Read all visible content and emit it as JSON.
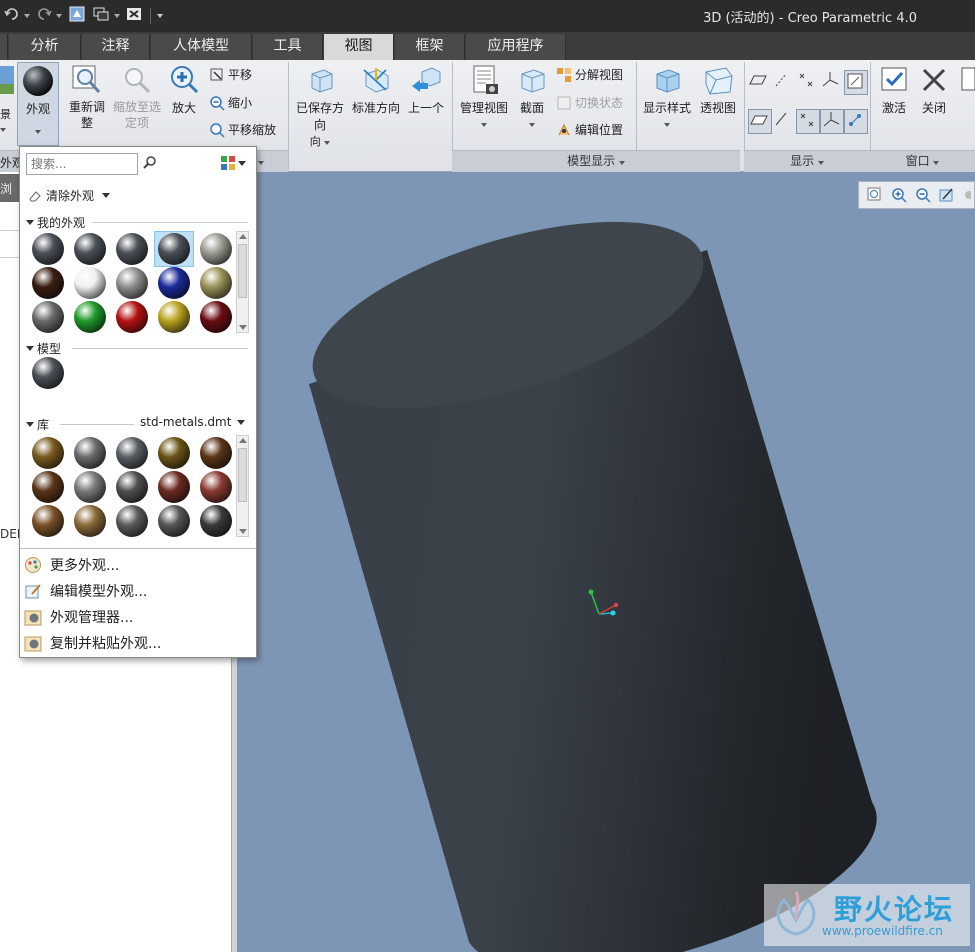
{
  "window": {
    "title": "3D (活动的) - Creo Parametric 4.0"
  },
  "tabs": [
    {
      "label": "分析"
    },
    {
      "label": "注释"
    },
    {
      "label": "人体模型"
    },
    {
      "label": "工具"
    },
    {
      "label": "视图"
    },
    {
      "label": "框架"
    },
    {
      "label": "应用程序"
    }
  ],
  "ribbon": {
    "appearance_label": "外观",
    "reset": "重新调整",
    "zoom_to_selected": "缩放至选定项",
    "zoom_in": "放大",
    "pan": "平移",
    "zoom_out": "缩小",
    "pan_zoom": "平移缩放",
    "saved_orientation": "已保存方向",
    "standard_orientation": "标准方向",
    "previous": "上一个",
    "manage_views": "管理视图",
    "section": "截面",
    "explode_view": "分解视图",
    "toggle_status": "切换状态",
    "edit_position": "编辑位置",
    "display_style": "显示样式",
    "perspective": "透视图",
    "activate": "激活",
    "close": "关闭",
    "group_orientation_fragment": "向",
    "group_model_display": "模型显示",
    "group_display": "显示",
    "group_window": "窗口",
    "left_fragment": "景"
  },
  "left_panel": {
    "tab_fragment": "浏",
    "label_fragment": "外观",
    "def_fragment": "DEF"
  },
  "dropdown": {
    "search_placeholder": "搜索...",
    "clear_appearance": "清除外观",
    "my_appearances": "我的外观",
    "model": "模型",
    "library": "库",
    "library_file": "std-metals.dmt",
    "more": "更多外观...",
    "edit_model": "编辑模型外观...",
    "manager": "外观管理器...",
    "copy_paste": "复制并粘贴外观..."
  },
  "colors": {
    "model_body": "#3d434b",
    "viewport_bg": "#7d96b5",
    "ribbon_bg": "#e6e8ec",
    "active_tab": "#d9d9d9"
  },
  "watermark": {
    "title": "野火论坛",
    "url": "www.proewildfire.cn"
  }
}
